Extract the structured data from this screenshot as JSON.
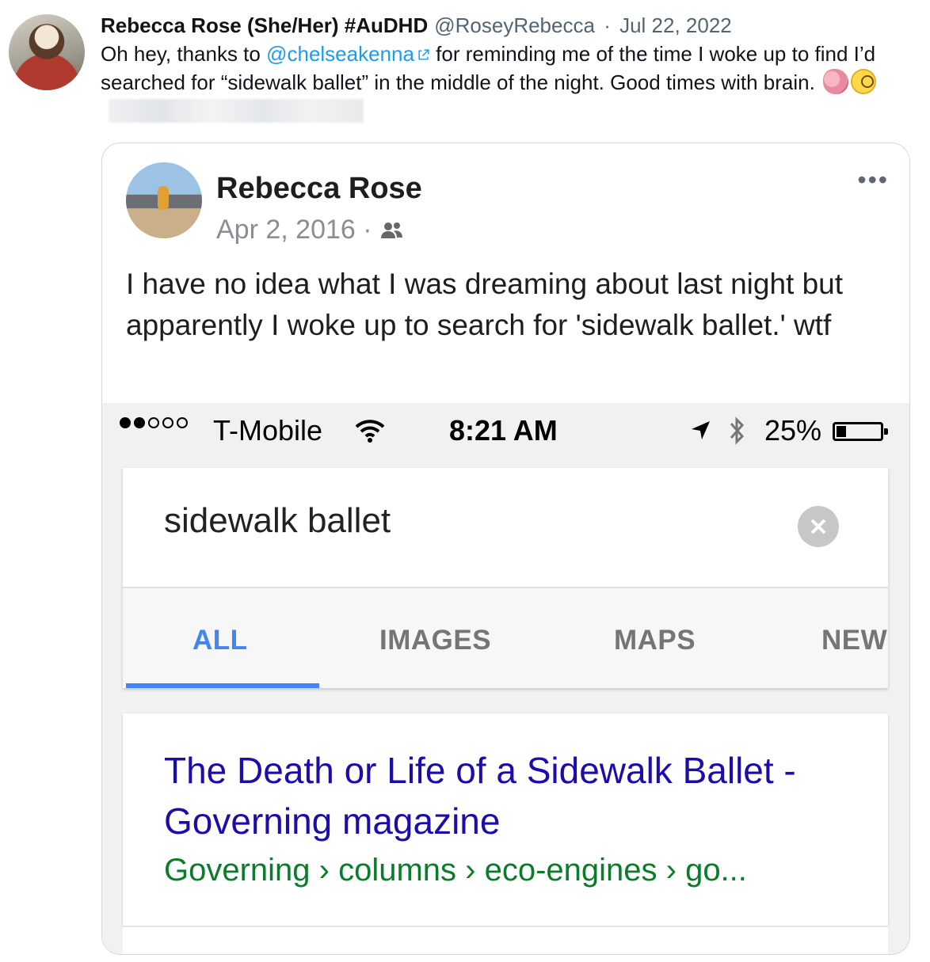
{
  "tweet": {
    "display_name": "Rebecca Rose (She/Her) #AuDHD",
    "handle": "@RoseyRebecca",
    "separator": "·",
    "date": "Jul 22, 2022",
    "text_before_mention": "Oh hey, thanks to ",
    "mention": "@chelseakenna",
    "text_after_mention": " for reminding me of the time I woke up to find I’d searched for “sidewalk ballet” in the middle of the night. Good times with brain.",
    "emojis": [
      "brain-emoji",
      "face-with-monocle-emoji"
    ],
    "colors": {
      "link": "#1d9bf0",
      "text": "#0f1419",
      "meta": "#536471"
    }
  },
  "fb_post": {
    "author": "Rebecca Rose",
    "date": "Apr 2, 2016 ·",
    "audience_icon": "friends-icon",
    "more_label": "•••",
    "text": "I have no idea what I was dreaming about last night but apparently I woke up to search for 'sidewalk ballet.' wtf"
  },
  "phone": {
    "status_bar": {
      "signal": {
        "filled": 2,
        "total": 5
      },
      "carrier": "T-Mobile",
      "time": "8:21 AM",
      "battery": "25%",
      "battery_level": 0.25
    },
    "search": {
      "query": "sidewalk ballet",
      "tabs": [
        "ALL",
        "IMAGES",
        "MAPS",
        "NEW"
      ],
      "active_tab": "ALL",
      "accent_color": "#4285f4"
    },
    "result": {
      "title": "The Death or Life of a Sidewalk Ballet - Governing magazine",
      "breadcrumb": "Governing › columns › eco-engines › go...",
      "title_color": "#1a0dab",
      "url_color": "#0a7c2a"
    }
  }
}
